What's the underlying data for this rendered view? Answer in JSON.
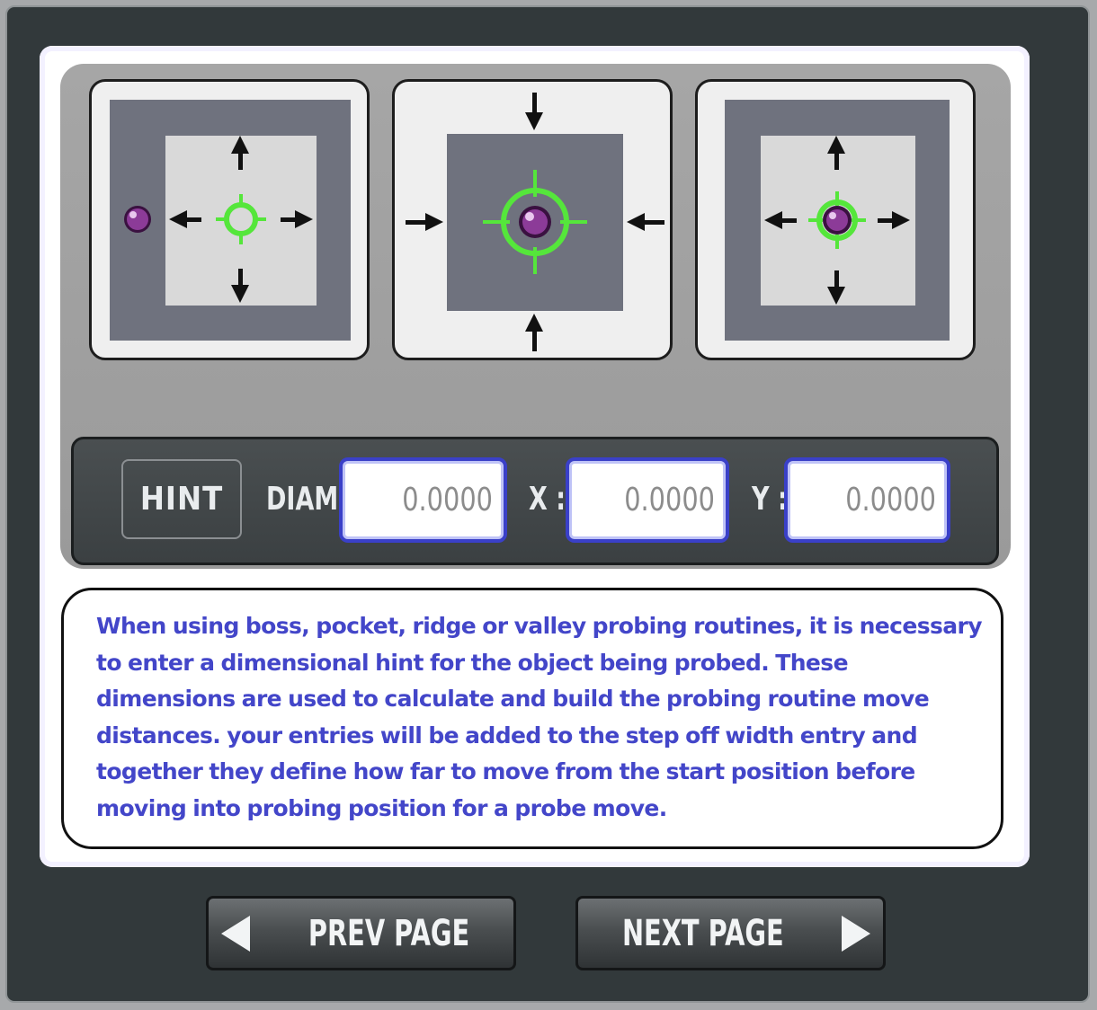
{
  "hint": {
    "button_label": "HINT",
    "diam_label": "DIAM:",
    "x_label": "X :",
    "y_label": "Y :",
    "diam_value": "0.0000",
    "x_value": "0.0000",
    "y_value": "0.0000"
  },
  "info_text": "When using boss, pocket, ridge or valley probing routines, it is necessary to enter a dimensional hint for the object being probed. These dimensions are used to calculate and build the probing routine move distances.  your entries will be added to the step off width entry and together they define how far to move from the start position before moving into probing position for a probe move.",
  "nav": {
    "prev_label": "PREV PAGE",
    "next_label": "NEXT PAGE"
  },
  "tiles": [
    {
      "name": "boss-probe-illustration"
    },
    {
      "name": "pocket-probe-illustration"
    },
    {
      "name": "inside-corner-probe-illustration"
    }
  ],
  "colors": {
    "accent_text": "#4346c9",
    "field_border": "#3a40c8",
    "target_green": "#55e63b",
    "probe_purple": "#7b2a86"
  }
}
